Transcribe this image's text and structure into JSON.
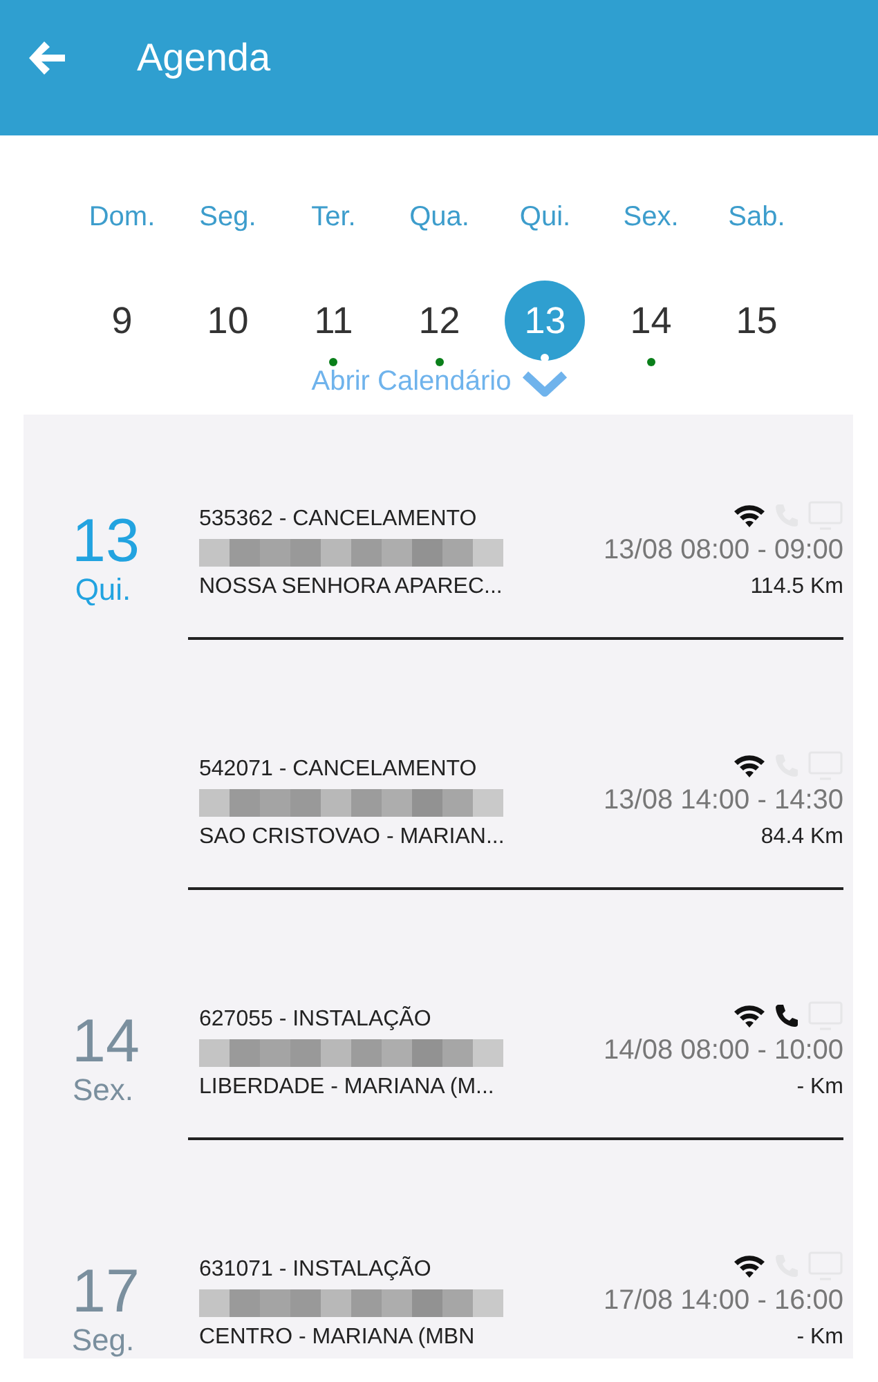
{
  "header": {
    "title": "Agenda"
  },
  "week": [
    {
      "weekday": "Dom.",
      "day": "9",
      "selected": false,
      "has_events": false
    },
    {
      "weekday": "Seg.",
      "day": "10",
      "selected": false,
      "has_events": false
    },
    {
      "weekday": "Ter.",
      "day": "11",
      "selected": false,
      "has_events": true
    },
    {
      "weekday": "Qua.",
      "day": "12",
      "selected": false,
      "has_events": true
    },
    {
      "weekday": "Qui.",
      "day": "13",
      "selected": true,
      "has_events": true
    },
    {
      "weekday": "Sex.",
      "day": "14",
      "selected": false,
      "has_events": true
    },
    {
      "weekday": "Sab.",
      "day": "15",
      "selected": false,
      "has_events": false
    }
  ],
  "open_calendar": "Abrir Calendário",
  "appointments": [
    {
      "day": "13",
      "weekday": "Qui.",
      "today": true,
      "title": "535362 - CANCELAMENTO",
      "name_redacted": true,
      "time": "13/08 08:00 - 09:00",
      "location": "NOSSA SENHORA APAREC...",
      "distance": "114.5 Km",
      "wifi": true,
      "phone": false,
      "tv": false
    },
    {
      "title": "542071 - CANCELAMENTO",
      "name_redacted": true,
      "time": "13/08 14:00 - 14:30",
      "location": "SAO CRISTOVAO - MARIAN...",
      "distance": "84.4 Km",
      "wifi": true,
      "phone": false,
      "tv": false
    },
    {
      "day": "14",
      "weekday": "Sex.",
      "today": false,
      "title": "627055 - INSTALAÇÃO",
      "name_redacted": true,
      "time": "14/08 08:00 - 10:00",
      "location": "LIBERDADE - MARIANA (M...",
      "distance": "- Km",
      "wifi": true,
      "phone": true,
      "tv": false
    },
    {
      "day": "17",
      "weekday": "Seg.",
      "today": false,
      "title": "631071 - INSTALAÇÃO",
      "name_redacted": true,
      "time": "17/08 14:00 - 16:00",
      "location": "CENTRO - MARIANA (MBN",
      "distance": "- Km",
      "wifi": true,
      "phone": false,
      "tv": false
    }
  ]
}
